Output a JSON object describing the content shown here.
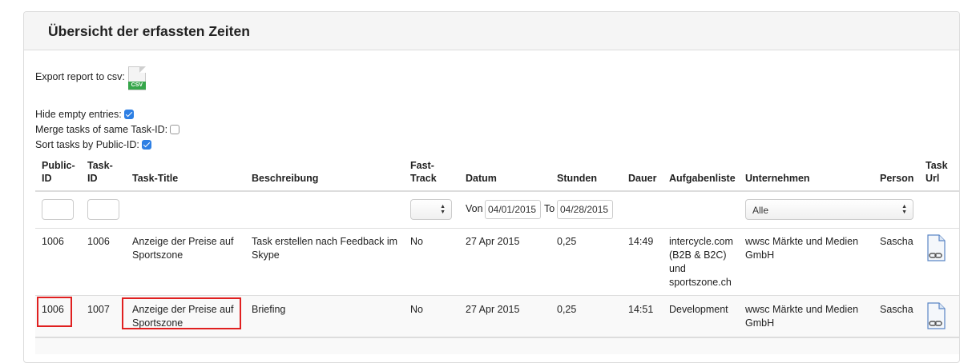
{
  "panel": {
    "title": "Übersicht der erfassten Zeiten"
  },
  "export": {
    "label": "Export report to csv:",
    "icon_badge": "CSV"
  },
  "options": [
    {
      "label": "Hide empty entries:",
      "checked": true
    },
    {
      "label": "Merge tasks of same Task-ID:",
      "checked": false
    },
    {
      "label": "Sort tasks by Public-ID:",
      "checked": true
    }
  ],
  "table": {
    "headers": {
      "public_id_1": "Public-",
      "public_id_2": "ID",
      "task_id_1": "Task-",
      "task_id_2": "ID",
      "task_title": "Task-Title",
      "beschreibung": "Beschreibung",
      "fast_track_1": "Fast-",
      "fast_track_2": "Track",
      "datum": "Datum",
      "stunden": "Stunden",
      "dauer": "Dauer",
      "aufgabenliste": "Aufgabenliste",
      "unternehmen": "Unternehmen",
      "person": "Person",
      "task_url_1": "Task",
      "task_url_2": "Url"
    },
    "filters": {
      "von_label": "Von",
      "von_value": "04/01/2015",
      "to_label": "To",
      "to_value": "04/28/2015",
      "unternehmen_selected": "Alle"
    },
    "rows": [
      {
        "public_id": "1006",
        "task_id": "1006",
        "title_1": "Anzeige der Preise auf",
        "title_2": "Sportszone",
        "desc_1": "Task erstellen nach Feedback im",
        "desc_2": "Skype",
        "fast_track": "No",
        "datum": "27 Apr 2015",
        "stunden": "0,25",
        "dauer": "14:49",
        "aufgabe_1": "intercycle.com",
        "aufgabe_2": "(B2B & B2C)",
        "aufgabe_3": "und",
        "aufgabe_4": "sportszone.ch",
        "firma_1": "wwsc Märkte und Medien",
        "firma_2": "GmbH",
        "person": "Sascha"
      },
      {
        "public_id": "1006",
        "task_id": "1007",
        "title_1": "Anzeige der Preise auf",
        "title_2": "Sportszone",
        "desc_1": "Briefing",
        "fast_track": "No",
        "datum": "27 Apr 2015",
        "stunden": "0,25",
        "dauer": "14:51",
        "aufgabe_1": "Development",
        "firma_1": "wwsc Märkte und Medien",
        "firma_2": "GmbH",
        "person": "Sascha"
      }
    ]
  },
  "colors": {
    "checkbox_on": "#2d7fe4",
    "csv_badge": "#35a64a",
    "highlight_box": "#e02020"
  }
}
